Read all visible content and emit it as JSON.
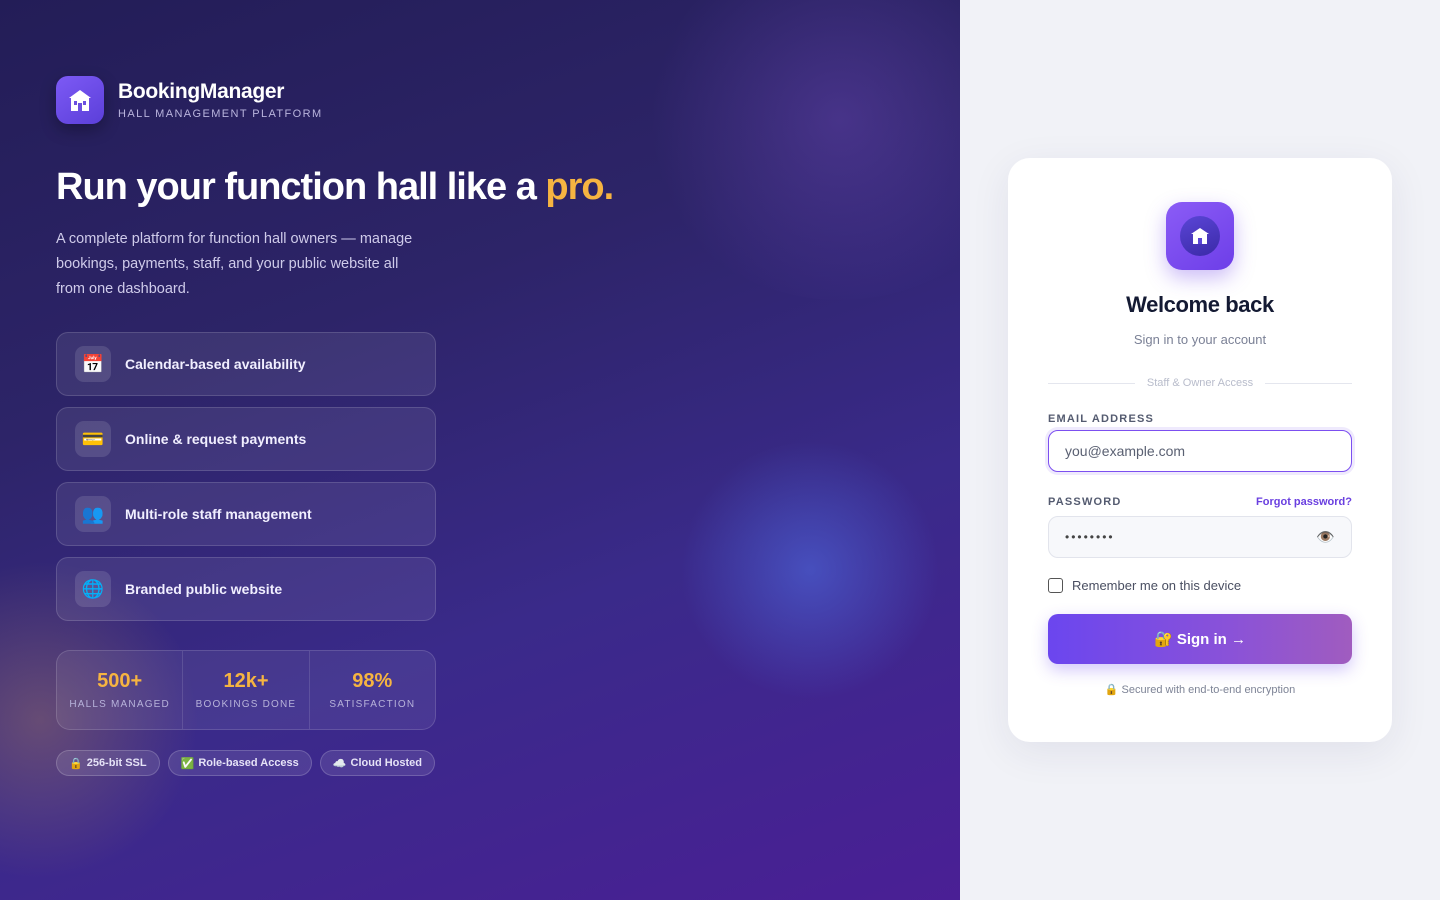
{
  "brand": {
    "name": "BookingManager",
    "tagline": "HALL MANAGEMENT PLATFORM"
  },
  "hero": {
    "headline_main": "Run your function hall like a ",
    "headline_accent": "pro.",
    "subtitle": "A complete platform for function hall owners — manage bookings, payments, staff, and your public website all from one dashboard.",
    "features": [
      {
        "icon": "calendar-icon",
        "glyph": "📅",
        "label": "Calendar-based availability"
      },
      {
        "icon": "credit-card-icon",
        "glyph": "💳",
        "label": "Online & request payments"
      },
      {
        "icon": "people-icon",
        "glyph": "👥",
        "label": "Multi-role staff management"
      },
      {
        "icon": "globe-icon",
        "glyph": "🌐",
        "label": "Branded public website"
      }
    ],
    "stats": [
      {
        "value": "500+",
        "label": "HALLS MANAGED"
      },
      {
        "value": "12k+",
        "label": "BOOKINGS DONE"
      },
      {
        "value": "98%",
        "label": "SATISFACTION"
      }
    ],
    "badges": [
      {
        "icon": "lock-icon",
        "glyph": "🔒",
        "label": "256-bit SSL"
      },
      {
        "icon": "check-icon",
        "glyph": "✅",
        "label": "Role-based Access"
      },
      {
        "icon": "cloud-icon",
        "glyph": "☁️",
        "label": "Cloud Hosted"
      }
    ]
  },
  "login": {
    "title": "Welcome back",
    "subtitle": "Sign in to your account",
    "divider_text": "Staff & Owner Access",
    "email_label": "EMAIL ADDRESS",
    "email_placeholder": "you@example.com",
    "password_label": "PASSWORD",
    "forgot_label": "Forgot password?",
    "password_masked": "••••••••",
    "eye_glyph": "👁️",
    "remember_label": "Remember me on this device",
    "signin_label": "🔐 Sign in →",
    "secure_note": "🔒 Secured with end-to-end encryption"
  },
  "colors": {
    "accent": "#f6b441",
    "primary": "#6b46ef",
    "hero_bg": "#2d2468"
  }
}
